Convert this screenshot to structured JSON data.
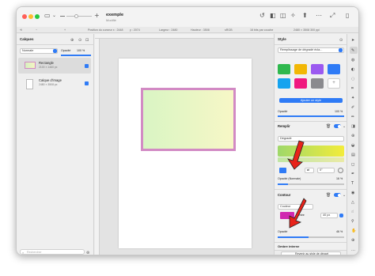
{
  "window": {
    "title": "exemple",
    "subtitle": "Modifié"
  },
  "infobar": {
    "position": "Position du curseur x : 2448",
    "y": "y : 2074",
    "width": "Largeur : 2480",
    "height": "Hauteur : 3508",
    "mode": "sRGB",
    "depth": "16 bits par couche",
    "size": "2480 × 3508 300 ppi"
  },
  "layers": {
    "title": "Calques",
    "blend_mode": "Normale",
    "opacity_label": "Opacité",
    "opacity_value": "100 %",
    "items": [
      {
        "name": "Rectangle",
        "size": "2100 × 1460 px"
      },
      {
        "name": "Calque d'image",
        "size": "2480 × 3508 px"
      }
    ],
    "search_placeholder": "Rechercher"
  },
  "style": {
    "title": "Style",
    "preset": "Remplissage de dégradé écla...",
    "swatch_colors": [
      "#2fb84e",
      "#f2b705",
      "#9b59f0",
      "#2f7bf6",
      "#15a3ef",
      "#f0187f",
      "#8a8a8e",
      "#ffffff"
    ],
    "add_style": "Ajouter un style",
    "opacity_label": "Opacité",
    "opacity_value": "100 %",
    "fill": {
      "title": "Remplir",
      "type": "Dégradé",
      "angle": "0°",
      "opacity_label": "Opacité (Normale)",
      "opacity_value": "16 %"
    },
    "stroke": {
      "title": "Contour",
      "position": "Couleur",
      "width": "40 px",
      "center_label": "Centre",
      "opacity_label": "Opacité",
      "opacity_value": "46 %"
    },
    "shadow_title": "Ombre interne",
    "reset": "Revenir au style de départ"
  },
  "colors": {
    "accent": "#2f7bf6",
    "stroke": "#d28ac4",
    "arrow": "#e8231a"
  }
}
